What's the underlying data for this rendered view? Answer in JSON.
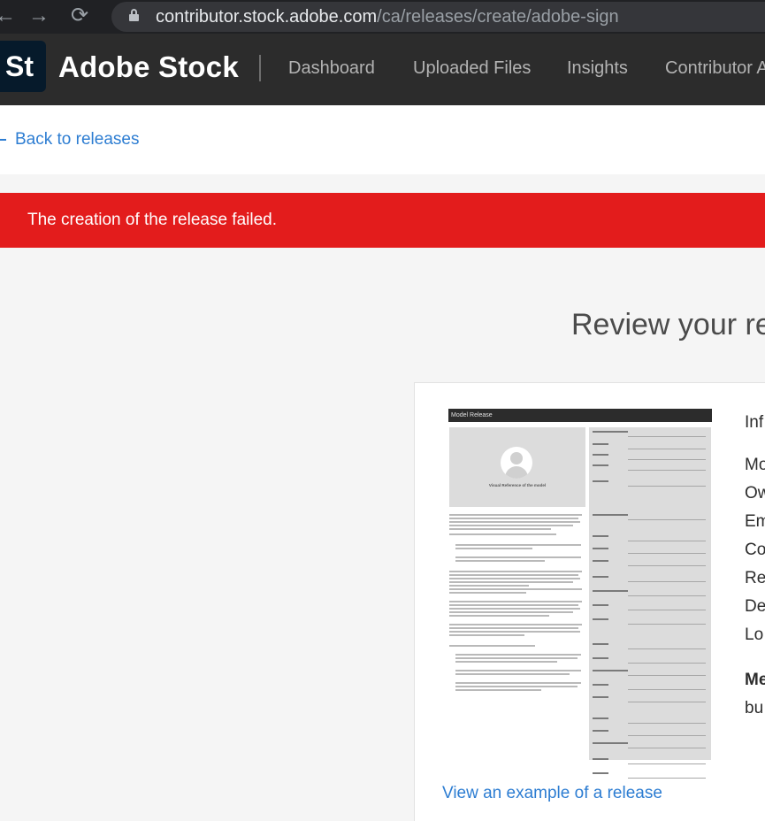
{
  "browser": {
    "back_glyph": "←",
    "forward_glyph": "→",
    "reload_glyph": "⟳",
    "url_host": "contributor.stock.adobe.com",
    "url_path": "/ca/releases/create/adobe-sign"
  },
  "header": {
    "logo": "St",
    "brand": "Adobe Stock",
    "nav": [
      "Dashboard",
      "Uploaded Files",
      "Insights",
      "Contributor A"
    ]
  },
  "back_link": "Back to releases",
  "error_banner": "The creation of the release failed.",
  "review_title": "Review your rec",
  "release_preview": {
    "header": "Model Release",
    "visual_caption": "Visual Reference of the model"
  },
  "example_link": "View an example of a release",
  "info_fragments": [
    "Inf",
    "Mo",
    "Ow",
    "Em",
    "Co",
    "Re",
    "De",
    "Lo",
    "Me",
    "bu"
  ],
  "colors": {
    "error": "#e31c1c",
    "link": "#2d7dd2",
    "header_bg": "#2c2c2c",
    "browser_bg": "#202124"
  }
}
